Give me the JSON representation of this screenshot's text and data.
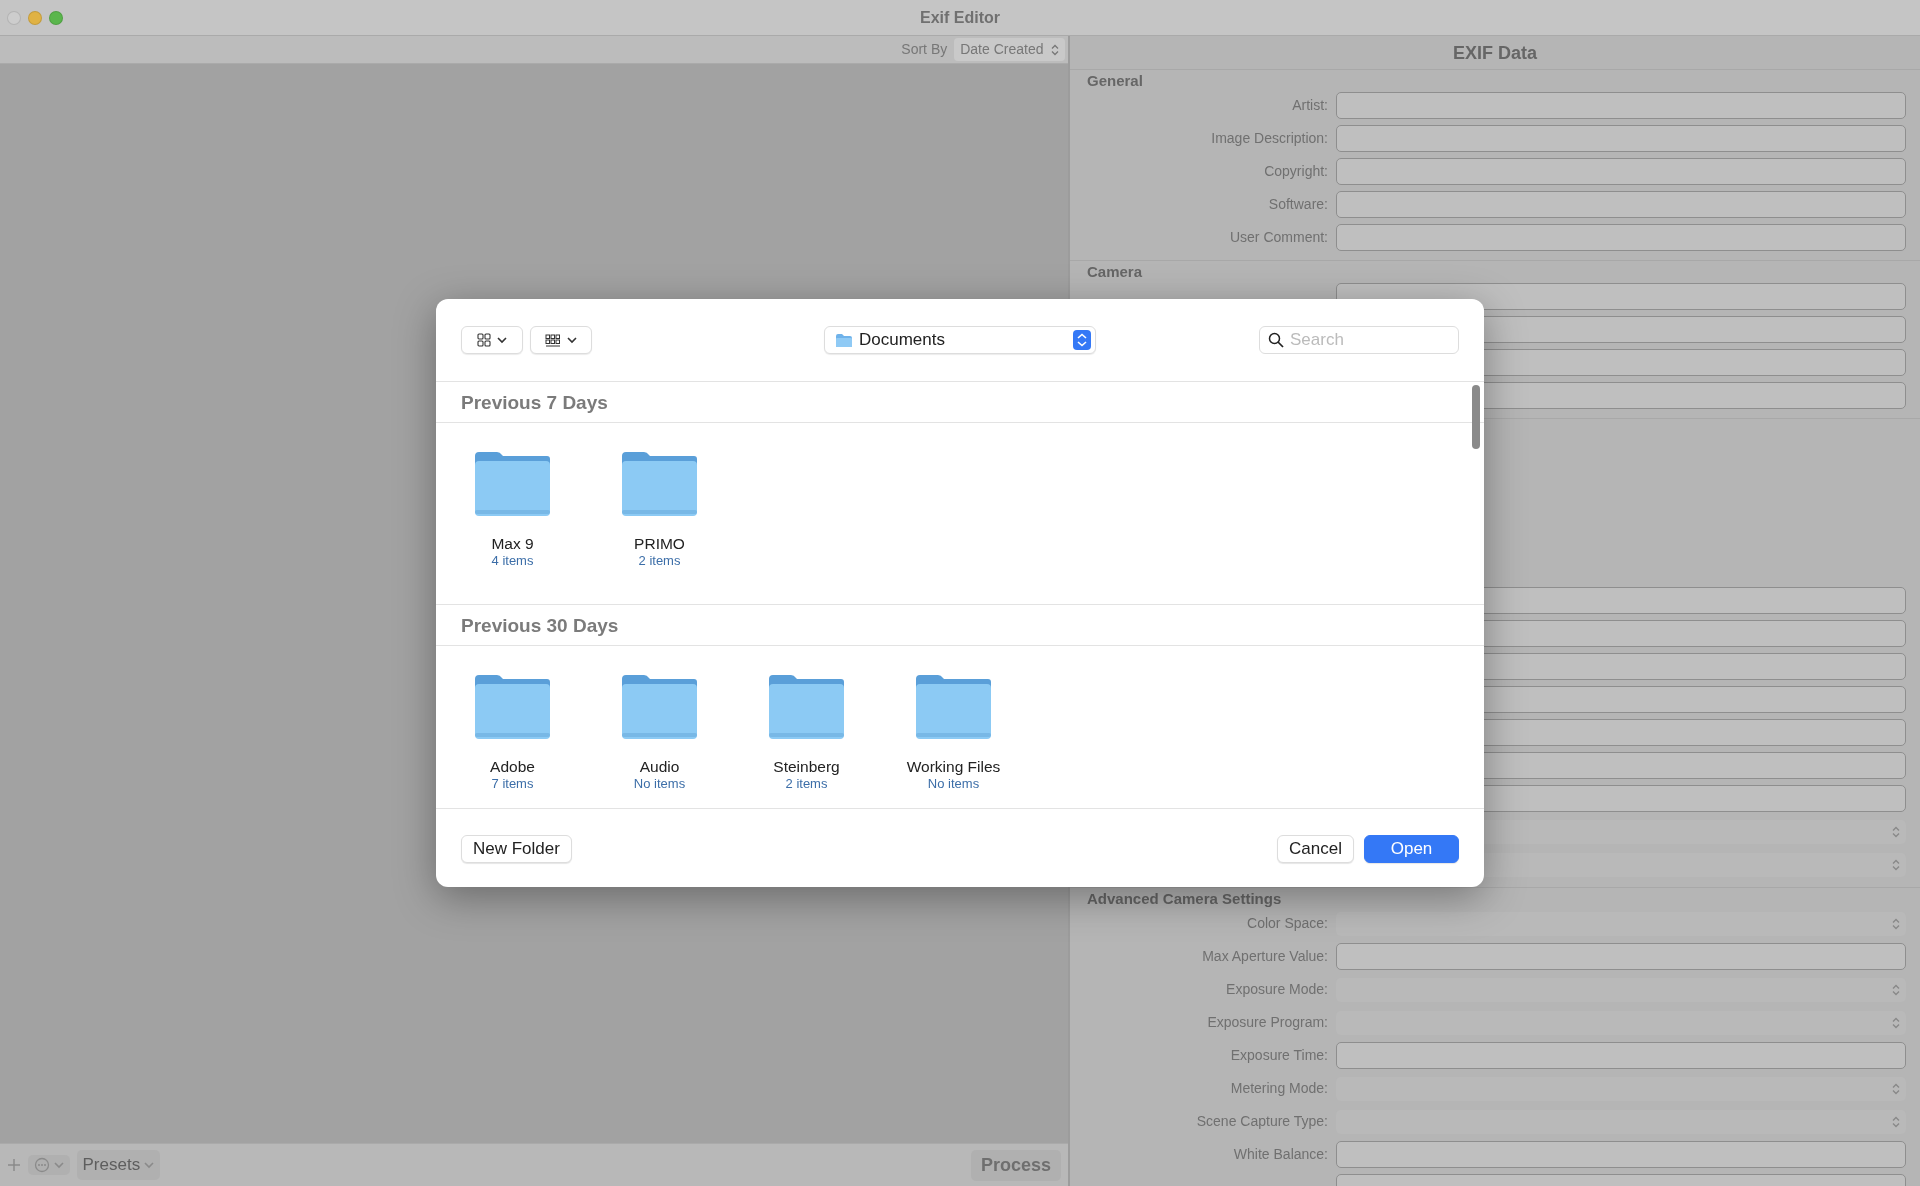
{
  "window": {
    "title": "Exif Editor"
  },
  "browser": {
    "sort_label": "Sort By",
    "sort_value": "Date Created"
  },
  "bottom_bar": {
    "presets": "Presets",
    "process": {
      "label": "Process",
      "disabled": true
    }
  },
  "inspector": {
    "title": "EXIF Data",
    "sections": [
      {
        "heading": "General",
        "rows": [
          {
            "kind": "text",
            "label": "Artist:"
          },
          {
            "kind": "text",
            "label": "Image Description:"
          },
          {
            "kind": "text",
            "label": "Copyright:"
          },
          {
            "kind": "text",
            "label": "Software:"
          },
          {
            "kind": "text",
            "label": "User Comment:"
          }
        ]
      },
      {
        "heading": "Camera",
        "rows": [
          {
            "kind": "text"
          },
          {
            "kind": "text"
          },
          {
            "kind": "text"
          },
          {
            "kind": "text"
          }
        ]
      },
      {
        "rows": [
          {
            "kind": "text"
          },
          {
            "kind": "text"
          },
          {
            "kind": "text"
          },
          {
            "kind": "text"
          },
          {
            "kind": "text"
          },
          {
            "kind": "text"
          },
          {
            "kind": "text"
          },
          {
            "kind": "select"
          },
          {
            "kind": "select"
          }
        ]
      },
      {
        "heading": "Advanced Camera Settings",
        "rows": [
          {
            "kind": "select",
            "label": "Color Space:"
          },
          {
            "kind": "text",
            "label": "Max Aperture Value:"
          },
          {
            "kind": "select",
            "label": "Exposure Mode:"
          },
          {
            "kind": "select",
            "label": "Exposure Program:"
          },
          {
            "kind": "text",
            "label": "Exposure Time:"
          },
          {
            "kind": "select",
            "label": "Metering Mode:"
          },
          {
            "kind": "select",
            "label": "Scene Capture Type:"
          },
          {
            "kind": "text",
            "label": "White Balance:"
          },
          {
            "kind": "text"
          }
        ]
      }
    ]
  },
  "dialog": {
    "location": "Documents",
    "search": {
      "placeholder": "Search"
    },
    "groups": [
      {
        "title": "Previous 7 Days",
        "items": [
          {
            "name": "Max 9",
            "count": "4 items"
          },
          {
            "name": "PRIMO",
            "count": "2 items"
          }
        ]
      },
      {
        "title": "Previous 30 Days",
        "items": [
          {
            "name": "Adobe",
            "count": "7 items"
          },
          {
            "name": "Audio",
            "count": "No items"
          },
          {
            "name": "Steinberg",
            "count": "2 items"
          },
          {
            "name": "Working Files",
            "count": "No items"
          }
        ]
      }
    ],
    "buttons": [
      {
        "label": "New Folder",
        "kind": "secondary"
      },
      {
        "label": "Cancel",
        "kind": "secondary"
      },
      {
        "label": "Open",
        "kind": "default"
      }
    ]
  }
}
